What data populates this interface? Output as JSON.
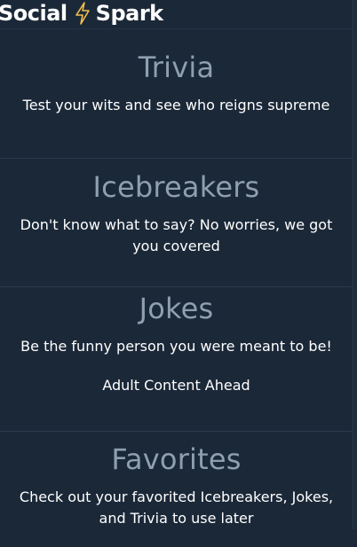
{
  "header": {
    "brand_left": "Social",
    "brand_right": "Spark",
    "brand_icon": "lightning-bolt-icon",
    "accent_color": "#f2c14e"
  },
  "colors": {
    "background": "#1b2838",
    "title": "#8e9fb0",
    "text": "#ffffff",
    "divider": "#2b3a4b"
  },
  "sections": [
    {
      "title": "Trivia",
      "description": "Test your wits and see who reigns supreme"
    },
    {
      "title": "Icebreakers",
      "description": "Don't know what to say? No worries, we got you covered"
    },
    {
      "title": "Jokes",
      "description": "Be the funny person you were meant to be!",
      "note": "Adult Content Ahead"
    },
    {
      "title": "Favorites",
      "description": "Check out your favorited Icebreakers, Jokes, and Trivia to use later"
    }
  ]
}
